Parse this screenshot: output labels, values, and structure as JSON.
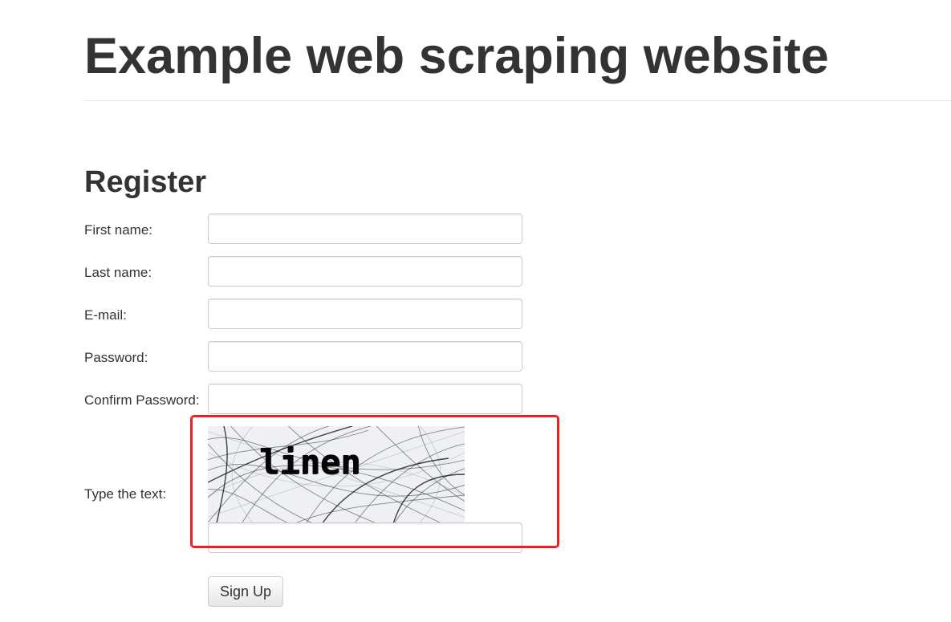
{
  "header": {
    "site_title": "Example web scraping website"
  },
  "form": {
    "title": "Register",
    "fields": [
      {
        "label": "First name:",
        "value": ""
      },
      {
        "label": "Last name:",
        "value": ""
      },
      {
        "label": "E-mail:",
        "value": ""
      },
      {
        "label": "Password:",
        "value": ""
      },
      {
        "label": "Confirm Password:",
        "value": ""
      }
    ],
    "captcha": {
      "label": "Type the text:",
      "image_text": "linen",
      "value": ""
    },
    "submit_label": "Sign Up"
  },
  "colors": {
    "text": "#333333",
    "highlight_border": "#e8231c",
    "input_border": "#cccccc"
  }
}
